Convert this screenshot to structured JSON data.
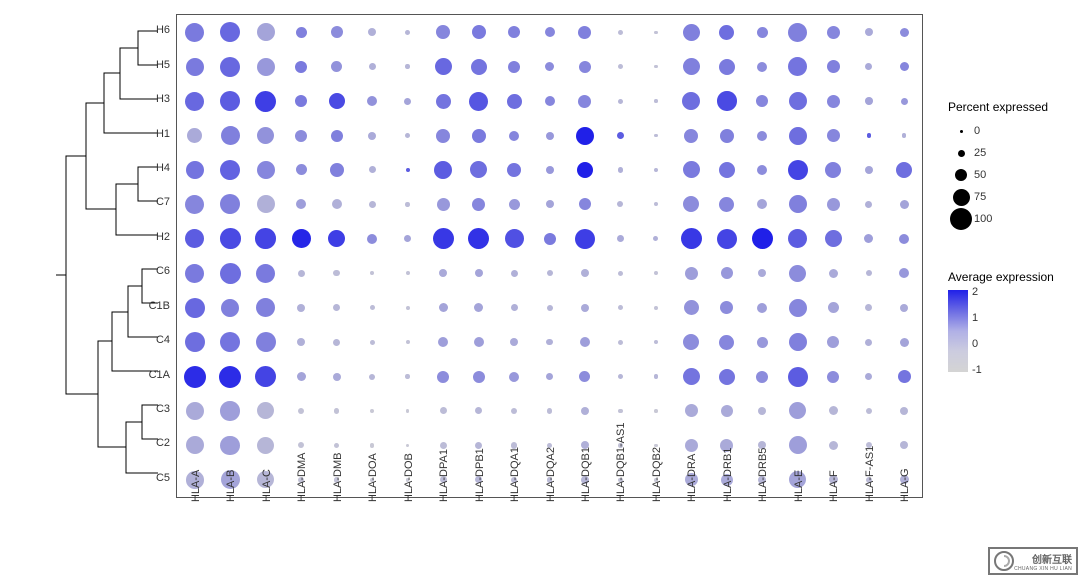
{
  "chart_data": {
    "type": "dotplot",
    "rows": [
      "H6",
      "H5",
      "H3",
      "H1",
      "H4",
      "C7",
      "H2",
      "C6",
      "C1B",
      "C4",
      "C1A",
      "C3",
      "C2",
      "C5"
    ],
    "cols": [
      "HLA-A",
      "HLA-B",
      "HLA-C",
      "HLA-DMA",
      "HLA-DMB",
      "HLA-DOA",
      "HLA-DOB",
      "HLA-DPA1",
      "HLA-DPB1",
      "HLA-DQA1",
      "HLA-DQA2",
      "HLA-DQB1",
      "HLA-DQB1-AS1",
      "HLA-DQB2",
      "HLA-DRA",
      "HLA-DRB1",
      "HLA-DRB5",
      "HLA-E",
      "HLA-F",
      "HLA-F-AS1",
      "HLA-G"
    ],
    "size_legend": {
      "title": "Percent expressed",
      "ticks": [
        0,
        25,
        50,
        75,
        100
      ]
    },
    "color_legend": {
      "title": "Average expression",
      "ticks": [
        2,
        1,
        0,
        -1
      ]
    },
    "values": [
      [
        [
          85,
          0.5
        ],
        [
          90,
          0.8
        ],
        [
          80,
          -0.2
        ],
        [
          45,
          0.4
        ],
        [
          50,
          0.2
        ],
        [
          30,
          -0.4
        ],
        [
          15,
          -0.5
        ],
        [
          60,
          0.3
        ],
        [
          60,
          0.5
        ],
        [
          50,
          0.4
        ],
        [
          40,
          0.3
        ],
        [
          55,
          0.4
        ],
        [
          15,
          -0.6
        ],
        [
          7,
          -0.7
        ],
        [
          75,
          0.4
        ],
        [
          65,
          0.7
        ],
        [
          45,
          0.3
        ],
        [
          85,
          0.4
        ],
        [
          55,
          0.3
        ],
        [
          30,
          -0.3
        ],
        [
          35,
          0.2
        ]
      ],
      [
        [
          80,
          0.5
        ],
        [
          90,
          0.8
        ],
        [
          80,
          0.0
        ],
        [
          50,
          0.5
        ],
        [
          45,
          0.1
        ],
        [
          25,
          -0.4
        ],
        [
          12,
          -0.5
        ],
        [
          75,
          0.8
        ],
        [
          70,
          0.6
        ],
        [
          50,
          0.4
        ],
        [
          35,
          0.2
        ],
        [
          50,
          0.3
        ],
        [
          15,
          -0.6
        ],
        [
          7,
          -0.7
        ],
        [
          75,
          0.4
        ],
        [
          70,
          0.5
        ],
        [
          40,
          0.2
        ],
        [
          85,
          0.6
        ],
        [
          55,
          0.4
        ],
        [
          25,
          -0.3
        ],
        [
          35,
          0.3
        ]
      ],
      [
        [
          85,
          0.8
        ],
        [
          90,
          1.0
        ],
        [
          95,
          1.5
        ],
        [
          50,
          0.5
        ],
        [
          70,
          1.3
        ],
        [
          40,
          0.1
        ],
        [
          25,
          -0.2
        ],
        [
          65,
          0.6
        ],
        [
          85,
          1.1
        ],
        [
          65,
          0.7
        ],
        [
          40,
          0.3
        ],
        [
          55,
          0.3
        ],
        [
          15,
          -0.5
        ],
        [
          8,
          -0.6
        ],
        [
          80,
          0.7
        ],
        [
          88,
          1.3
        ],
        [
          50,
          0.3
        ],
        [
          80,
          0.7
        ],
        [
          55,
          0.3
        ],
        [
          28,
          -0.2
        ],
        [
          25,
          0.0
        ]
      ],
      [
        [
          65,
          -0.3
        ],
        [
          85,
          0.4
        ],
        [
          75,
          0.1
        ],
        [
          50,
          0.2
        ],
        [
          50,
          0.4
        ],
        [
          30,
          -0.3
        ],
        [
          15,
          -0.5
        ],
        [
          60,
          0.3
        ],
        [
          60,
          0.5
        ],
        [
          40,
          0.3
        ],
        [
          30,
          0.0
        ],
        [
          80,
          2.2
        ],
        [
          25,
          1.0
        ],
        [
          8,
          -0.6
        ],
        [
          60,
          0.3
        ],
        [
          60,
          0.4
        ],
        [
          40,
          0.2
        ],
        [
          80,
          0.7
        ],
        [
          55,
          0.3
        ],
        [
          12,
          1.0
        ],
        [
          12,
          -0.4
        ]
      ],
      [
        [
          80,
          0.6
        ],
        [
          90,
          0.9
        ],
        [
          80,
          0.3
        ],
        [
          45,
          0.2
        ],
        [
          60,
          0.4
        ],
        [
          25,
          -0.4
        ],
        [
          10,
          1.0
        ],
        [
          80,
          1.0
        ],
        [
          75,
          0.7
        ],
        [
          60,
          0.6
        ],
        [
          30,
          0.0
        ],
        [
          70,
          2.0
        ],
        [
          18,
          -0.4
        ],
        [
          10,
          -0.5
        ],
        [
          75,
          0.5
        ],
        [
          70,
          0.6
        ],
        [
          40,
          0.2
        ],
        [
          90,
          1.4
        ],
        [
          70,
          0.4
        ],
        [
          30,
          -0.2
        ],
        [
          70,
          0.7
        ]
      ],
      [
        [
          85,
          0.3
        ],
        [
          90,
          0.4
        ],
        [
          80,
          -0.4
        ],
        [
          40,
          -0.1
        ],
        [
          40,
          -0.4
        ],
        [
          25,
          -0.5
        ],
        [
          12,
          -0.6
        ],
        [
          55,
          0.0
        ],
        [
          55,
          0.3
        ],
        [
          45,
          0.0
        ],
        [
          30,
          -0.2
        ],
        [
          50,
          0.3
        ],
        [
          20,
          -0.5
        ],
        [
          10,
          -0.6
        ],
        [
          70,
          0.2
        ],
        [
          65,
          0.3
        ],
        [
          40,
          -0.2
        ],
        [
          80,
          0.4
        ],
        [
          55,
          0.0
        ],
        [
          25,
          -0.4
        ],
        [
          35,
          -0.2
        ]
      ],
      [
        [
          85,
          1.0
        ],
        [
          93,
          1.3
        ],
        [
          93,
          1.4
        ],
        [
          85,
          1.9
        ],
        [
          75,
          1.5
        ],
        [
          40,
          0.2
        ],
        [
          25,
          -0.2
        ],
        [
          95,
          1.6
        ],
        [
          95,
          1.7
        ],
        [
          85,
          1.2
        ],
        [
          50,
          0.5
        ],
        [
          90,
          1.5
        ],
        [
          25,
          -0.3
        ],
        [
          15,
          -0.4
        ],
        [
          95,
          1.6
        ],
        [
          90,
          1.4
        ],
        [
          95,
          2.2
        ],
        [
          85,
          1.0
        ],
        [
          75,
          0.7
        ],
        [
          35,
          -0.1
        ],
        [
          40,
          0.2
        ]
      ],
      [
        [
          85,
          0.5
        ],
        [
          95,
          0.7
        ],
        [
          85,
          0.5
        ],
        [
          25,
          -0.5
        ],
        [
          22,
          -0.6
        ],
        [
          12,
          -0.7
        ],
        [
          10,
          -0.7
        ],
        [
          30,
          -0.3
        ],
        [
          30,
          -0.2
        ],
        [
          25,
          -0.4
        ],
        [
          20,
          -0.5
        ],
        [
          30,
          -0.4
        ],
        [
          15,
          -0.6
        ],
        [
          10,
          -0.7
        ],
        [
          55,
          -0.1
        ],
        [
          50,
          0.0
        ],
        [
          30,
          -0.3
        ],
        [
          75,
          0.2
        ],
        [
          35,
          -0.3
        ],
        [
          20,
          -0.5
        ],
        [
          40,
          0.0
        ]
      ],
      [
        [
          90,
          0.8
        ],
        [
          80,
          0.4
        ],
        [
          85,
          0.4
        ],
        [
          30,
          -0.4
        ],
        [
          25,
          -0.5
        ],
        [
          15,
          -0.6
        ],
        [
          10,
          -0.7
        ],
        [
          35,
          -0.2
        ],
        [
          35,
          -0.2
        ],
        [
          25,
          -0.4
        ],
        [
          20,
          -0.5
        ],
        [
          30,
          -0.3
        ],
        [
          15,
          -0.6
        ],
        [
          10,
          -0.7
        ],
        [
          65,
          0.1
        ],
        [
          55,
          0.2
        ],
        [
          40,
          -0.1
        ],
        [
          80,
          0.3
        ],
        [
          45,
          -0.2
        ],
        [
          25,
          -0.5
        ],
        [
          30,
          -0.3
        ]
      ],
      [
        [
          90,
          0.7
        ],
        [
          90,
          0.6
        ],
        [
          90,
          0.4
        ],
        [
          30,
          -0.4
        ],
        [
          25,
          -0.5
        ],
        [
          15,
          -0.6
        ],
        [
          10,
          -0.7
        ],
        [
          40,
          -0.1
        ],
        [
          40,
          -0.1
        ],
        [
          30,
          -0.3
        ],
        [
          22,
          -0.4
        ],
        [
          40,
          -0.1
        ],
        [
          15,
          -0.6
        ],
        [
          10,
          -0.6
        ],
        [
          70,
          0.2
        ],
        [
          65,
          0.3
        ],
        [
          45,
          0.0
        ],
        [
          80,
          0.4
        ],
        [
          50,
          -0.1
        ],
        [
          25,
          -0.4
        ],
        [
          35,
          -0.2
        ]
      ],
      [
        [
          100,
          1.8
        ],
        [
          100,
          1.8
        ],
        [
          95,
          1.4
        ],
        [
          35,
          -0.2
        ],
        [
          30,
          -0.3
        ],
        [
          20,
          -0.5
        ],
        [
          12,
          -0.6
        ],
        [
          50,
          0.2
        ],
        [
          50,
          0.2
        ],
        [
          40,
          0.0
        ],
        [
          25,
          -0.2
        ],
        [
          45,
          0.2
        ],
        [
          18,
          -0.5
        ],
        [
          12,
          -0.5
        ],
        [
          75,
          0.6
        ],
        [
          70,
          0.6
        ],
        [
          50,
          0.2
        ],
        [
          90,
          1.0
        ],
        [
          50,
          0.2
        ],
        [
          25,
          -0.3
        ],
        [
          55,
          0.6
        ]
      ],
      [
        [
          80,
          -0.3
        ],
        [
          88,
          -0.1
        ],
        [
          75,
          -0.5
        ],
        [
          20,
          -0.7
        ],
        [
          18,
          -0.7
        ],
        [
          12,
          -0.8
        ],
        [
          8,
          -0.8
        ],
        [
          25,
          -0.6
        ],
        [
          25,
          -0.5
        ],
        [
          22,
          -0.6
        ],
        [
          18,
          -0.6
        ],
        [
          30,
          -0.4
        ],
        [
          12,
          -0.7
        ],
        [
          8,
          -0.8
        ],
        [
          55,
          -0.3
        ],
        [
          50,
          -0.3
        ],
        [
          30,
          -0.5
        ],
        [
          75,
          -0.1
        ],
        [
          35,
          -0.5
        ],
        [
          20,
          -0.6
        ],
        [
          30,
          -0.5
        ]
      ],
      [
        [
          80,
          -0.3
        ],
        [
          88,
          -0.1
        ],
        [
          75,
          -0.5
        ],
        [
          20,
          -0.7
        ],
        [
          18,
          -0.7
        ],
        [
          12,
          -0.8
        ],
        [
          8,
          -0.8
        ],
        [
          25,
          -0.6
        ],
        [
          25,
          -0.5
        ],
        [
          22,
          -0.6
        ],
        [
          18,
          -0.6
        ],
        [
          30,
          -0.4
        ],
        [
          12,
          -0.7
        ],
        [
          8,
          -0.8
        ],
        [
          55,
          -0.3
        ],
        [
          55,
          -0.3
        ],
        [
          30,
          -0.5
        ],
        [
          80,
          -0.1
        ],
        [
          35,
          -0.5
        ],
        [
          20,
          -0.6
        ],
        [
          30,
          -0.5
        ]
      ],
      [
        [
          78,
          -0.4
        ],
        [
          85,
          -0.2
        ],
        [
          75,
          -0.5
        ],
        [
          20,
          -0.7
        ],
        [
          18,
          -0.7
        ],
        [
          12,
          -0.8
        ],
        [
          8,
          -0.8
        ],
        [
          25,
          -0.6
        ],
        [
          25,
          -0.5
        ],
        [
          22,
          -0.6
        ],
        [
          18,
          -0.6
        ],
        [
          28,
          -0.5
        ],
        [
          12,
          -0.7
        ],
        [
          8,
          -0.8
        ],
        [
          55,
          -0.3
        ],
        [
          50,
          -0.3
        ],
        [
          30,
          -0.5
        ],
        [
          75,
          -0.2
        ],
        [
          35,
          -0.5
        ],
        [
          20,
          -0.6
        ],
        [
          35,
          -0.4
        ]
      ]
    ]
  },
  "watermark": {
    "main": "创新互联",
    "sub": "CHUANG XIN HU LIAN"
  }
}
